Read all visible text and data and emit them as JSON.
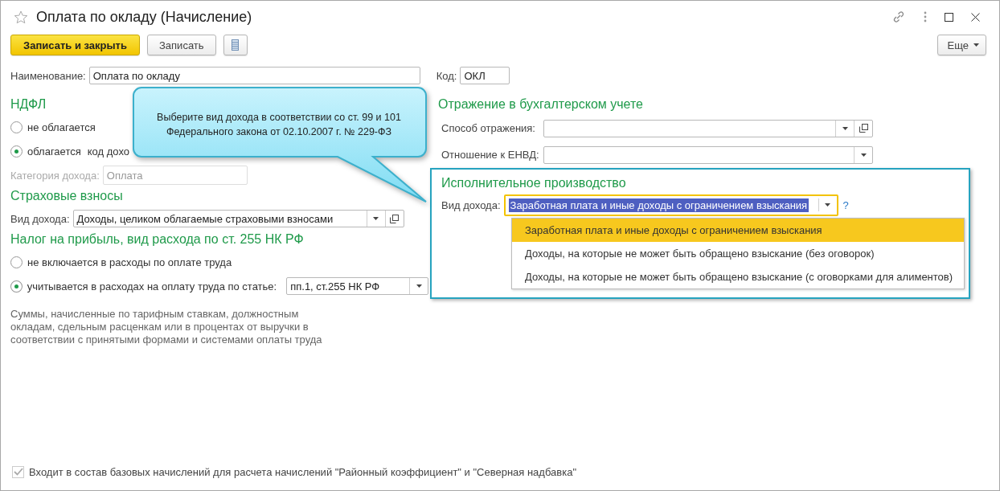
{
  "window": {
    "title": "Оплата по окладу (Начисление)"
  },
  "toolbar": {
    "buttons": [
      {
        "kind": "primary",
        "label": "Записать и закрыть"
      },
      {
        "kind": "normal",
        "label": "Записать"
      },
      {
        "kind": "icon"
      }
    ],
    "more": "Еще"
  },
  "header_fields": [
    {
      "label": "Наименование:",
      "value": "Оплата по окладу",
      "kind": "wide"
    },
    {
      "label": "Код:",
      "value": "ОКЛ",
      "kind": "short"
    }
  ],
  "ndfl": {
    "title": "НДФЛ",
    "options": [
      {
        "label": "не облагается",
        "selected": false
      },
      {
        "label": "облагается",
        "selected": true,
        "extra": "код дохо"
      }
    ],
    "category": {
      "label": "Категория дохода:",
      "value": "Оплата",
      "disabled": true
    }
  },
  "insurance": {
    "title": "Страховые взносы",
    "field": {
      "label": "Вид дохода:",
      "value": "Доходы, целиком облагаемые страховыми взносами"
    }
  },
  "profit_tax": {
    "title": "Налог на прибыль, вид расхода по ст. 255 НК РФ",
    "options": [
      {
        "label": "не включается в расходы по оплате труда",
        "selected": false
      },
      {
        "label": "учитывается в расходах на оплату труда по статье:",
        "selected": true,
        "value": "пп.1, ст.255 НК РФ"
      }
    ],
    "note": "Суммы, начисленные по тарифным ставкам, должностным окладам, сдельным расценкам или в процентах от выручки в соответствии с принятыми формами и системами оплаты труда"
  },
  "accounting": {
    "title": "Отражение в бухгалтерском учете",
    "fields": [
      {
        "label": "Способ отражения:",
        "kind": "select_open"
      },
      {
        "label": "Отношение к ЕНВД:",
        "kind": "select"
      }
    ]
  },
  "enforcement": {
    "title": "Исполнительное производство",
    "field": {
      "label": "Вид дохода:",
      "value": "Заработная плата и иные доходы с ограничением взыскания",
      "help": "?"
    },
    "dropdown": [
      {
        "label": "Заработная плата и иные доходы с ограничением взыскания",
        "selected": true
      },
      {
        "label": "Доходы, на которые не может быть обращено взыскание (без оговорок)",
        "selected": false
      },
      {
        "label": "Доходы, на которые не может быть обращено взыскание (с оговорками для алиментов)",
        "selected": false
      }
    ]
  },
  "callout": {
    "text": "Выберите вид дохода в соответствии со ст. 99 и 101\nФедерального закона от 02.10.2007 г. № 229-ФЗ"
  },
  "footer_checkbox": {
    "label": "Входит в состав базовых начислений для расчета начислений \"Районный коэффициент\" и \"Северная надбавка\"",
    "checked": true,
    "disabled": true
  }
}
